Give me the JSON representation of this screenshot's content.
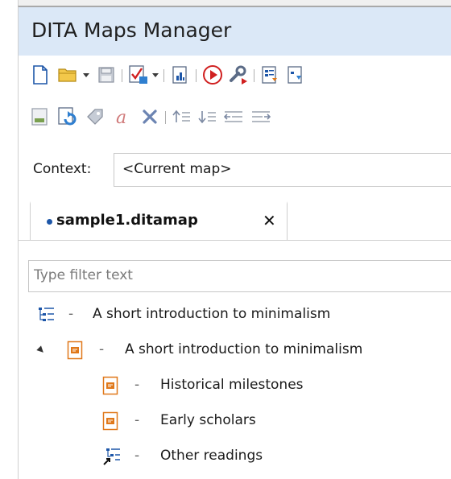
{
  "panel": {
    "title": "DITA Maps Manager"
  },
  "context": {
    "label": "Context:",
    "value": "<Current map>"
  },
  "tabs": [
    {
      "label": "sample1.ditamap",
      "modified": true,
      "close": "✕"
    }
  ],
  "filter": {
    "placeholder": "Type filter text"
  },
  "tree": [
    {
      "label": "A short introduction to minimalism",
      "dash": "-",
      "icon": "map-root-icon",
      "level": 0
    },
    {
      "label": "A short introduction to minimalism",
      "dash": "-",
      "icon": "topic-icon",
      "level": 1,
      "expanded": true
    },
    {
      "label": "Historical milestones",
      "dash": "-",
      "icon": "topic-icon",
      "level": 2
    },
    {
      "label": "Early scholars",
      "dash": "-",
      "icon": "topic-icon",
      "level": 2
    },
    {
      "label": "Other readings",
      "dash": "-",
      "icon": "map-reference-icon",
      "level": 2
    }
  ],
  "toolbar_icons": {
    "row1": [
      "new-file-icon",
      "open-folder-icon",
      "save-icon",
      "validate-icon",
      "report-icon",
      "run-transformation-icon",
      "configure-transformation-icon",
      "insert-topic-ref-icon",
      "insert-reference-icon"
    ],
    "row2": [
      "edit-properties-icon",
      "refresh-references-icon",
      "edit-attributes-icon",
      "rename-icon",
      "delete-icon",
      "move-up-icon",
      "move-down-icon",
      "promote-icon",
      "demote-icon"
    ]
  },
  "colors": {
    "title_bar": "#dbe8f7",
    "accent_blue": "#1d56a8",
    "topic_orange": "#e0781a",
    "danger_red": "#d02020"
  }
}
